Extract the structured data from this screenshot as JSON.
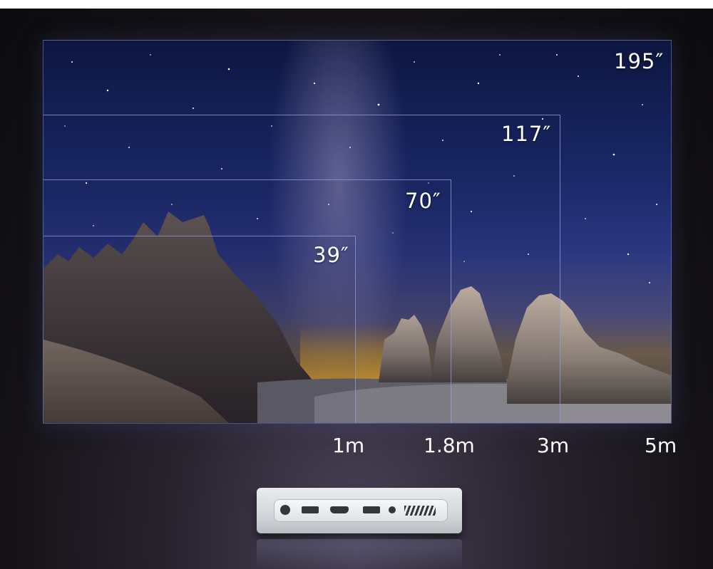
{
  "screen_sizes": [
    "195″",
    "117″",
    "70″",
    "39″"
  ],
  "distances": [
    "1m",
    "1.8m",
    "3m",
    "5m"
  ],
  "colors": {
    "frame_line": "#9aa0dc",
    "label": "#ffffff"
  },
  "icons": [
    "power-port-icon",
    "usb-port-icon",
    "hdmi-port-icon",
    "audio-jack-icon",
    "vent-icon"
  ]
}
